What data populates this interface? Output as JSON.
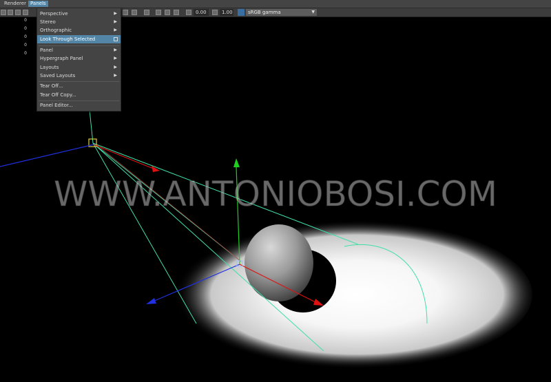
{
  "menubar": {
    "items": [
      "Renderer",
      "Panels"
    ]
  },
  "toolbar": {
    "exposure_value": "0.00",
    "gamma_value": "1.00",
    "color_space": "sRGB gamma"
  },
  "left_values": [
    "0",
    "0",
    "0",
    "0",
    "0"
  ],
  "dropdown": {
    "items": [
      "Perspective",
      "Stereo",
      "Orthographic",
      "Look Through Selected",
      "Panel",
      "Hypergraph Panel",
      "Layouts",
      "Saved Layouts",
      "Tear Off...",
      "Tear Off Copy...",
      "Panel Editor..."
    ]
  },
  "watermark": "WWW.ANTONIOBOSI.COM",
  "colors": {
    "menu_highlight": "#5285a6",
    "light_lines": "#3fe0a6",
    "axis_x": "#e01010",
    "axis_y": "#20d020",
    "axis_z": "#2030e0"
  }
}
